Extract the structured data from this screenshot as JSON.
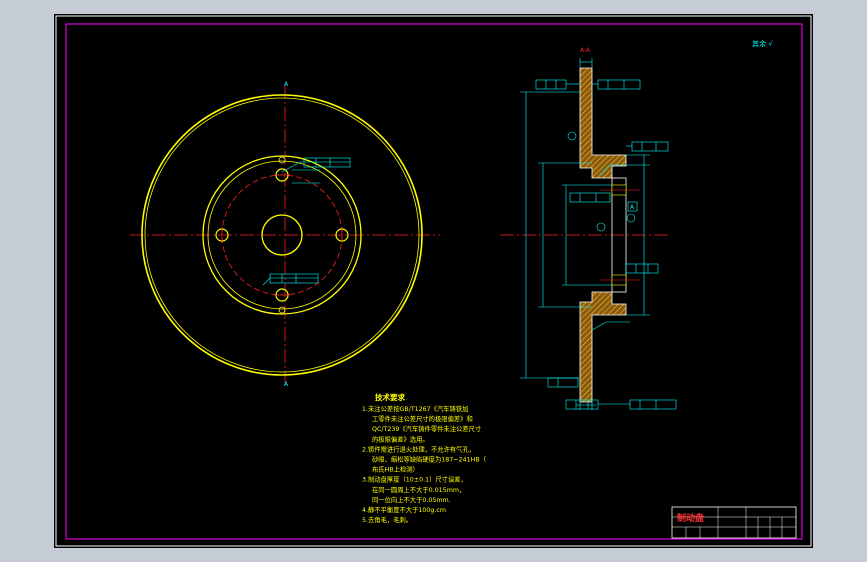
{
  "colors": {
    "app_background": "#c5ccd6",
    "sheet": "#000000",
    "frame_outer": "#ffffff",
    "frame_inner": "#ff00ff",
    "outline": "#ffff00",
    "center_line": "#ff2020",
    "dimension": "#00ffff",
    "section": "#ffffff"
  },
  "sheet": {
    "roughness_note": "其余 √"
  },
  "front_view": {
    "datum_top": "A",
    "datum_bottom": "A"
  },
  "section_view": {
    "section_label": "A-A",
    "datum_label": "A"
  },
  "technical_requirements": {
    "title": "技术要求",
    "items": [
      "1.未注公差按GB/T1267《汽车铸铁加",
      "工零件未注公差尺寸的极限偏差》和",
      "QC/T239《汽车铸件零件未注公差尺寸",
      "的极限偏差》选用。",
      "2.铸件需进行退火处理，不允许有气孔，",
      "砂眼、缩松等缺陷硬度为187~241HB（",
      "布氏HB上检测）",
      "3.制动盘厚度（10±0.1）尺寸误差，",
      "在同一圆周上不大于0.015mm，",
      "同一位向上不大于0.05mm.",
      "4.静不平衡度不大于100g.cm",
      "5.去角毛，毛刺。"
    ]
  },
  "title_block": {
    "part_name": "制动盘"
  }
}
